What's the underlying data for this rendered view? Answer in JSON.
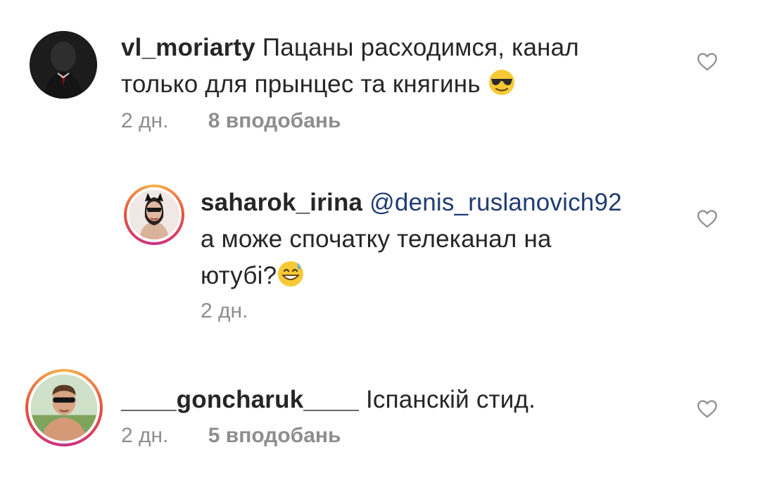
{
  "comments": [
    {
      "username": "vl_moriarty",
      "text_line1": "Пацаны расходимся, канал",
      "text_line2": "только для прынцес та княгинь",
      "emoji": "smiling-face-with-sunglasses",
      "time": "2 дн.",
      "likes": "8 вподобань"
    },
    {
      "username": "saharok_irina",
      "mention": "@denis_ruslanovich92",
      "text_line1": "а може спочатку телеканал на",
      "text_line2": "ютубі?",
      "emoji": "grinning-face-with-sweat",
      "time": "2 дн."
    },
    {
      "username": "____goncharuk____",
      "text": "Іспанскій стид.",
      "time": "2 дн.",
      "likes": "5 вподобань"
    }
  ],
  "colors": {
    "text": "#262626",
    "meta": "#8e8e8e",
    "mention": "#1f3c72",
    "story_ring_start": "#f6b54a",
    "story_ring_end": "#c92f86"
  },
  "icons": {
    "like": "heart-outline-icon"
  }
}
